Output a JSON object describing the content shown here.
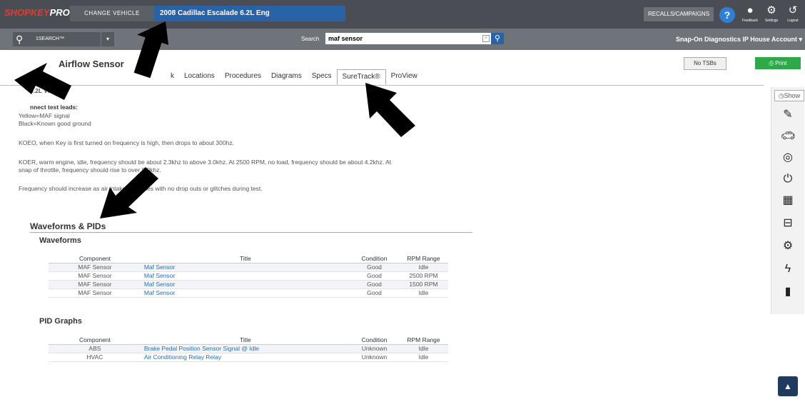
{
  "header": {
    "logo_left": "SHOPKEY",
    "logo_right": "PRO",
    "change_vehicle": "CHANGE VEHICLE",
    "vehicle": "2008 Cadillac Escalade 6.2L Eng",
    "recalls": "RECALLS/CAMPAIGNS",
    "help": "?",
    "tools": [
      {
        "label": "Feedback",
        "icon": "feedback-icon"
      },
      {
        "label": "Settings",
        "icon": "gear-icon"
      },
      {
        "label": "Logout",
        "icon": "logout-icon"
      }
    ]
  },
  "search": {
    "quick_label": "1SEARCH™",
    "label": "Search",
    "value": "maf sensor",
    "account": "Snap-On Diagnostics IP House Account ▾"
  },
  "page": {
    "title": "Airflow Sensor",
    "tabs": [
      "k",
      "Locations",
      "Procedures",
      "Diagrams",
      "Specs",
      "SureTrack®",
      "ProView"
    ],
    "active_tab": "SureTrack®",
    "no_tsbs": "No TSBs",
    "print": "Print"
  },
  "content": {
    "engine_line": "6.2L VIN 8",
    "connect_heading": "nnect test leads:",
    "lead1": "Yellow=MAF signal",
    "lead2": "Black=Known good ground",
    "koeo": "KOEO, when Key is first turned on frequency is high, then drops to about 300hz.",
    "koer1": "KOER, warm engine, idle, frequency should be about 2.3khz to above 3.0khz. At 2500 RPM, no load, frequency should be about 4.2khz. At",
    "koer2": "snap of throttle, frequency should rise to over 8.0khz.",
    "freq": "Frequency should increase as air intake increases with no drop outs or glitches during test."
  },
  "waveforms_pids": {
    "heading": "Waveforms & PIDs",
    "waveforms_heading": "Waveforms",
    "columns": [
      "Component",
      "Title",
      "Condition",
      "RPM Range"
    ],
    "waveforms": [
      [
        "MAF Sensor",
        "Maf Sensor",
        "Good",
        "Idle"
      ],
      [
        "MAF Sensor",
        "Maf Sensor",
        "Good",
        "2500 RPM"
      ],
      [
        "MAF Sensor",
        "Maf Sensor",
        "Good",
        "1500 RPM"
      ],
      [
        "MAF Sensor",
        "Maf Sensor",
        "Good",
        "Idle"
      ]
    ],
    "pid_heading": "PID Graphs",
    "pids": [
      [
        "ABS",
        "Brake Pedal Position Sensor Signal @ Idle",
        "Unknown",
        "Idle"
      ],
      [
        "HVAC",
        "Air Conditioning Relay Relay",
        "Unknown",
        "Idle"
      ]
    ]
  },
  "sidebar": {
    "show": "Show",
    "icons": [
      "edit-note-icon",
      "vehicle-icon",
      "webcam-icon",
      "power-icon",
      "book-icon",
      "module-icon",
      "engine-icon",
      "electrical-icon",
      "battery-icon"
    ]
  },
  "colors": {
    "accent": "#2a62a8",
    "topbar": "#4a4e54",
    "print": "#2fa84a",
    "link": "#2a6fb5"
  }
}
